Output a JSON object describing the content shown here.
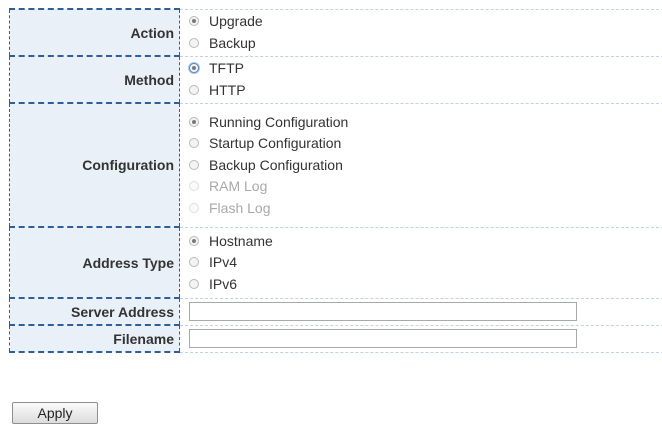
{
  "form": {
    "action": {
      "label": "Action",
      "options": [
        {
          "label": "Upgrade",
          "checked": true
        },
        {
          "label": "Backup",
          "checked": false
        }
      ]
    },
    "method": {
      "label": "Method",
      "options": [
        {
          "label": "TFTP",
          "checked": true
        },
        {
          "label": "HTTP",
          "checked": false
        }
      ]
    },
    "configuration": {
      "label": "Configuration",
      "options": [
        {
          "label": "Running Configuration",
          "checked": true,
          "disabled": false
        },
        {
          "label": "Startup Configuration",
          "checked": false,
          "disabled": false
        },
        {
          "label": "Backup Configuration",
          "checked": false,
          "disabled": false
        },
        {
          "label": "RAM Log",
          "checked": false,
          "disabled": true
        },
        {
          "label": "Flash Log",
          "checked": false,
          "disabled": true
        }
      ]
    },
    "address_type": {
      "label": "Address Type",
      "options": [
        {
          "label": "Hostname",
          "checked": true
        },
        {
          "label": "IPv4",
          "checked": false
        },
        {
          "label": "IPv6",
          "checked": false
        }
      ]
    },
    "server_address": {
      "label": "Server Address",
      "value": ""
    },
    "filename": {
      "label": "Filename",
      "value": ""
    }
  },
  "buttons": {
    "apply_label": "Apply"
  },
  "colors": {
    "label_background": "#e9f0f8",
    "label_border": "#2e5f9a",
    "disabled_text": "#a9a9a9"
  }
}
